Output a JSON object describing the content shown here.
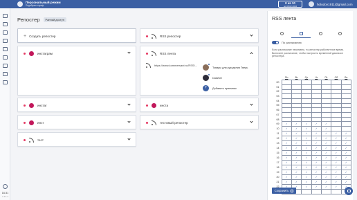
{
  "brand": {
    "title": "Персональный режим",
    "subtitle": "Подобрать тариф"
  },
  "counter": {
    "main": "0 из 10",
    "sub": "до 08.02.2022"
  },
  "user": {
    "email": "holodov1911@gmail.com"
  },
  "sidebar": {
    "time": "16:31",
    "version": "v 1.1.1"
  },
  "page": {
    "title": "Репостер",
    "badge": "Ранний доступ"
  },
  "left_column": {
    "add_label": "Создать репостер",
    "cards": [
      {
        "icon": "instagram-icon",
        "label": "инстаграм"
      },
      {
        "icon": "instagram-icon",
        "label": "инстаг"
      },
      {
        "icon": "instagram-icon",
        "label": "инст"
      },
      {
        "icon": "rss-icon",
        "label": "тест"
      }
    ]
  },
  "right_column": {
    "cards": [
      {
        "icon": "rss-icon",
        "label": "RSS репостер"
      },
      {
        "icon": "rss-icon",
        "label": "RSS лента",
        "expanded": true,
        "url": "https://www.kommersant.ru/RSS/...",
        "channels": [
          {
            "name": "Товары для рукоделия Тверь",
            "color": "#8a6e5a",
            "badge": "1"
          },
          {
            "name": "DataSet",
            "color": "#2c2c3a",
            "badge": "2"
          },
          {
            "name": "Добавить приемник",
            "color": "#3b5fa3",
            "badge": ""
          }
        ]
      },
      {
        "icon": "instagram-icon",
        "label": "инста"
      },
      {
        "icon": "rss-icon",
        "label": "тестовый репостер"
      }
    ]
  },
  "panel": {
    "title": "RSS лента",
    "tabs": [
      "settings-icon",
      "calendar-icon",
      "account-icon",
      "history-icon"
    ],
    "active_tab": 1,
    "toggle_label": "По расписанию",
    "toggle_on": true,
    "description": "Если расписание неактивно, то репостер работает все время. Включите расписание, чтобы настроить временной диапазон репостера.",
    "days": [
      "Пн",
      "Вт",
      "Ср",
      "Чт",
      "Пт",
      "Сб",
      "Вс"
    ],
    "hours": [
      "00",
      "01",
      "02",
      "03",
      "04",
      "05",
      "06",
      "07",
      "08",
      "09",
      "10",
      "11",
      "12",
      "13",
      "14",
      "15",
      "16",
      "17",
      "18",
      "19",
      "20",
      "21",
      "22",
      "23"
    ],
    "check_glyph": "✓",
    "checked": [
      [
        0,
        0,
        0,
        0,
        0,
        0,
        0
      ],
      [
        0,
        0,
        0,
        0,
        0,
        0,
        0
      ],
      [
        0,
        0,
        0,
        0,
        0,
        0,
        0
      ],
      [
        0,
        0,
        0,
        0,
        0,
        0,
        0
      ],
      [
        0,
        0,
        0,
        0,
        0,
        0,
        0
      ],
      [
        0,
        0,
        0,
        0,
        0,
        0,
        0
      ],
      [
        0,
        0,
        0,
        0,
        0,
        0,
        0
      ],
      [
        0,
        0,
        0,
        0,
        0,
        0,
        0
      ],
      [
        0,
        0,
        0,
        0,
        0,
        0,
        0
      ],
      [
        1,
        1,
        1,
        1,
        1,
        0,
        0
      ],
      [
        1,
        1,
        1,
        1,
        1,
        0,
        0
      ],
      [
        1,
        1,
        1,
        1,
        1,
        1,
        1
      ],
      [
        1,
        1,
        1,
        1,
        1,
        1,
        1
      ],
      [
        1,
        1,
        1,
        1,
        1,
        1,
        1
      ],
      [
        1,
        1,
        1,
        1,
        1,
        1,
        1
      ],
      [
        1,
        1,
        1,
        1,
        1,
        1,
        1
      ],
      [
        1,
        1,
        1,
        1,
        1,
        1,
        1
      ],
      [
        1,
        1,
        1,
        1,
        1,
        1,
        1
      ],
      [
        1,
        1,
        1,
        1,
        1,
        1,
        1
      ],
      [
        1,
        1,
        1,
        1,
        1,
        1,
        1
      ],
      [
        1,
        1,
        1,
        1,
        1,
        1,
        1
      ],
      [
        1,
        1,
        1,
        1,
        1,
        1,
        1
      ],
      [
        1,
        1,
        1,
        1,
        1,
        1,
        1
      ],
      [
        0,
        0,
        0,
        0,
        0,
        0,
        0
      ]
    ],
    "save_label": "Сохранить"
  },
  "colors": {
    "accent": "#3b5fa3",
    "status_dot": "#e53a63",
    "instagram": "#c2185b"
  }
}
